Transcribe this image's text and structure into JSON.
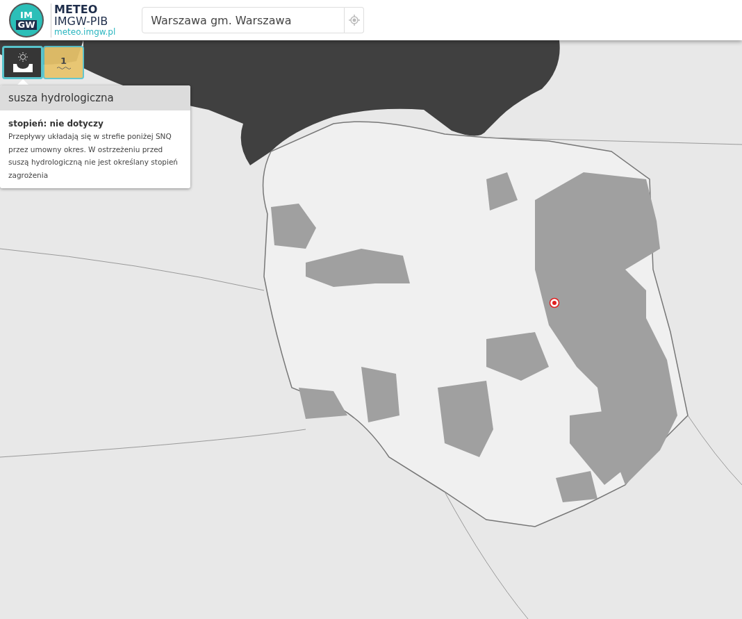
{
  "header": {
    "logo": {
      "top": "IM",
      "bottom": "GW"
    },
    "brand": {
      "title": "METEO",
      "subtitle": "IMGW-PIB",
      "url": "meteo.imgw.pl"
    },
    "search": {
      "value": "Warszawa gm. Warszawa"
    }
  },
  "warning_tabs": [
    {
      "kind": "icon",
      "selected": true
    },
    {
      "kind": "level",
      "label": "1",
      "selected": false
    }
  ],
  "popup": {
    "title": "susza hydrologiczna",
    "degree": "stopień: nie dotyczy",
    "description": "Przepływy układają się w strefie poniżej SNQ przez umowny okres. W ostrzeżeniu przed suszą hydrologiczną nie jest określany stopień zagrożenia"
  }
}
